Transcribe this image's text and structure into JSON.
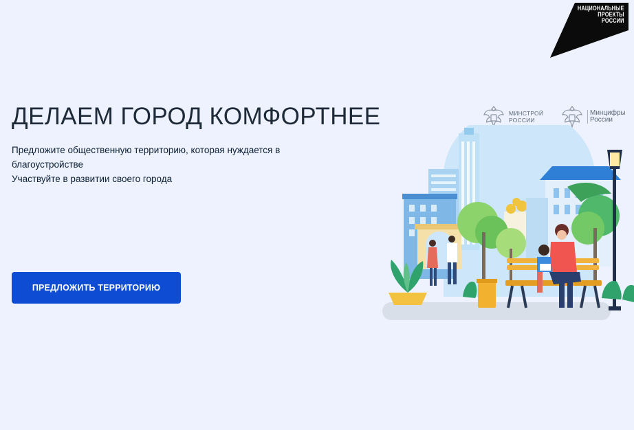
{
  "brand": {
    "national_projects_lines": [
      "НАЦИОНАЛЬНЫЕ",
      "ПРОЕКТЫ",
      "РОССИИ"
    ]
  },
  "hero": {
    "title": "ДЕЛАЕМ ГОРОД КОМФОРТНЕЕ",
    "description_line1": "Предложите общественную территорию, которая нуждается в благоустройстве",
    "description_line2": "Участвуйте в развитии своего города",
    "cta_label": "ПРЕДЛОЖИТЬ ТЕРРИТОРИЮ"
  },
  "ministries": [
    {
      "lines": [
        "МИНСТРОЙ",
        "РОССИИ"
      ],
      "icon": "coat-of-arms-icon"
    },
    {
      "lines": [
        "Минцифры",
        "России"
      ],
      "icon": "coat-of-arms-icon"
    }
  ],
  "colors": {
    "background": "#edf2fe",
    "primary_button": "#0d4cd3",
    "title_text": "#1e2a38",
    "logo_black": "#0b0b0b"
  }
}
